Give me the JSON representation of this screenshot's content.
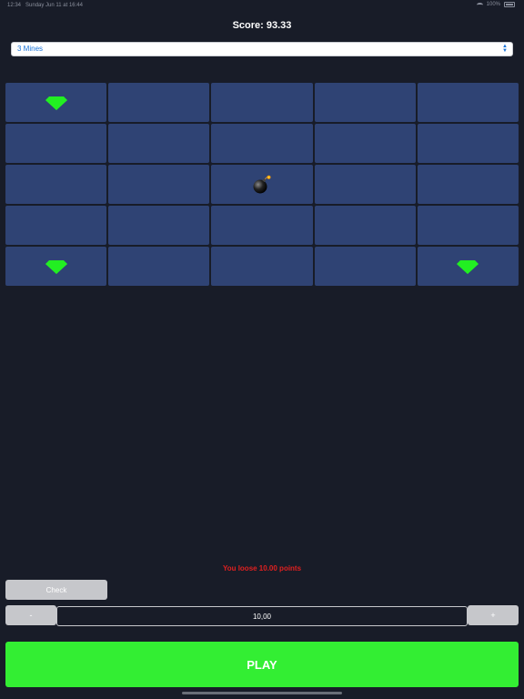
{
  "statusbar": {
    "time": "12:34",
    "date": "Sunday Jun 11 at 16:44",
    "battery": "100%"
  },
  "score_label": "Score: 93.33",
  "mines_select": {
    "selected": "3 Mines"
  },
  "board": {
    "rows": 5,
    "cols": 5,
    "tiles": [
      "gem",
      "hidden",
      "hidden",
      "hidden",
      "hidden",
      "hidden",
      "hidden",
      "hidden",
      "hidden",
      "hidden",
      "hidden",
      "hidden",
      "bomb",
      "hidden",
      "hidden",
      "hidden",
      "hidden",
      "hidden",
      "hidden",
      "hidden",
      "gem",
      "hidden",
      "hidden",
      "hidden",
      "gem"
    ],
    "tile_color": "#2f4374",
    "gem_color": "#22ee22"
  },
  "result_message": "You loose 10.00 points",
  "controls": {
    "check_label": "Check",
    "minus_label": "-",
    "plus_label": "+",
    "bet_value": "10,00",
    "play_label": "PLAY"
  },
  "colors": {
    "background": "#181c28",
    "play": "#33ee33",
    "loss": "#e02020"
  }
}
